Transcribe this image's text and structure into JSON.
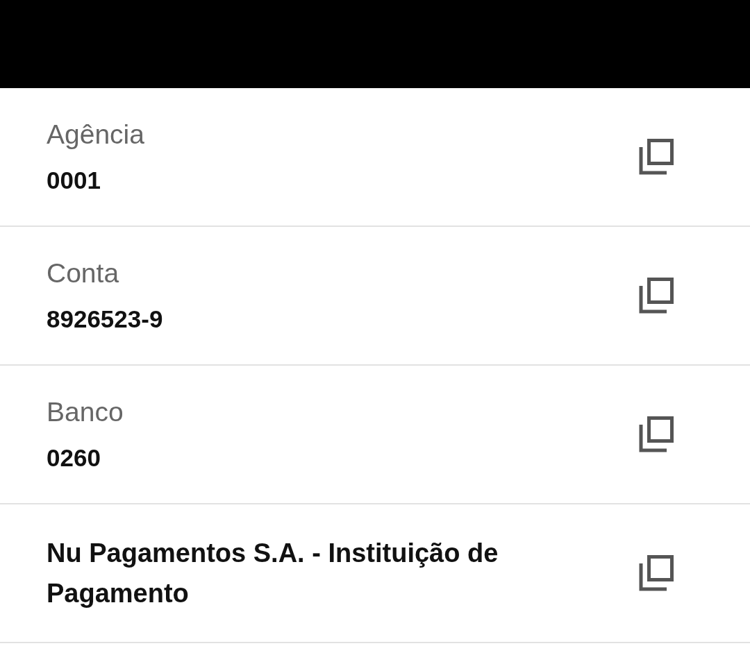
{
  "rows": [
    {
      "kind": "field",
      "label": "Agência",
      "value": "0001"
    },
    {
      "kind": "field",
      "label": "Conta",
      "value": "8926523-9"
    },
    {
      "kind": "field",
      "label": "Banco",
      "value": "0260"
    },
    {
      "kind": "title",
      "value": "Nu Pagamentos S.A. - Instituição de Pagamento"
    }
  ]
}
